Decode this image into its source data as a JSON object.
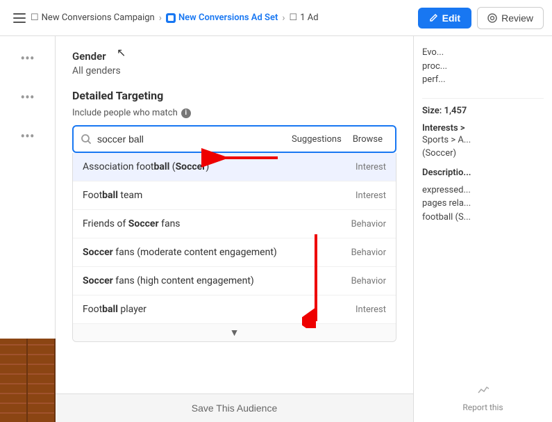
{
  "topbar": {
    "toggle_label": "☰",
    "breadcrumb": {
      "campaign": "New Conversions Campaign",
      "adset": "New Conversions Ad Set",
      "ad": "1 Ad"
    },
    "edit_label": "Edit",
    "review_label": "Review"
  },
  "sidebar": {
    "dots1": "•••",
    "dots2": "•••",
    "dots3": "•••"
  },
  "content": {
    "gender_label": "Gender",
    "gender_value": "All genders",
    "detailed_targeting_title": "Detailed Targeting",
    "include_label": "Include people who match",
    "search_placeholder": "soccer ball",
    "suggestions_tab": "Suggestions",
    "browse_tab": "Browse",
    "results": [
      {
        "name_parts": [
          "Association foot",
          "ball (",
          "Soccer",
          ")"
        ],
        "name_html": "Association football (Soccer)",
        "bold_parts": [
          "ball",
          "Soccer"
        ],
        "type": "Interest"
      },
      {
        "name_html": "Football team",
        "bold_parts": [
          "ball"
        ],
        "type": "Interest"
      },
      {
        "name_html": "Friends of Soccer fans",
        "bold_parts": [
          "Soccer"
        ],
        "type": "Behavior"
      },
      {
        "name_html": "Soccer fans (moderate content engagement)",
        "bold_parts": [
          "Soccer"
        ],
        "type": "Behavior"
      },
      {
        "name_html": "Soccer fans (high content engagement)",
        "bold_parts": [
          "Soccer"
        ],
        "type": "Behavior"
      },
      {
        "name_html": "Football player",
        "bold_parts": [
          "ball"
        ],
        "type": "Interest"
      }
    ],
    "save_audience_label": "Save This Audience"
  },
  "right_panel": {
    "intro_text": "Evo... proc... perf...",
    "size_label": "Size: 1,457",
    "interests_label": "Interests >",
    "interests_detail": "Sports > A... (Soccer)",
    "description_label": "Descriptio...",
    "description_text": "expressed... pages rela... football (S...",
    "report_label": "Report this"
  }
}
